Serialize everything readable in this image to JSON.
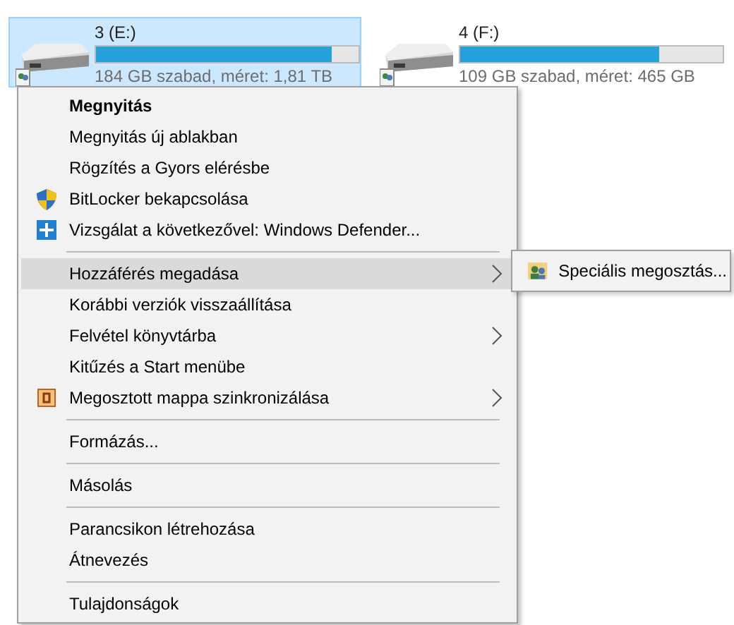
{
  "drives": [
    {
      "name": "3 (E:)",
      "level": 0.9,
      "info": "184 GB szabad, méret: 1,81 TB",
      "selected": true
    },
    {
      "name": "4 (F:)",
      "level": 0.76,
      "info": "109 GB szabad, méret: 465 GB",
      "selected": false
    }
  ],
  "context_menu": [
    {
      "kind": "item",
      "label": "Megnyitás",
      "bold": true,
      "selected": false
    },
    {
      "kind": "item",
      "label": "Megnyitás új ablakban",
      "selected": false
    },
    {
      "kind": "item",
      "label": "Rögzítés a Gyors elérésbe",
      "selected": false
    },
    {
      "kind": "shield",
      "label": "BitLocker bekapcsolása",
      "selected": false
    },
    {
      "kind": "defender",
      "label": "Vizsgálat a következővel: Windows Defender...",
      "selected": false
    },
    {
      "kind": "separator"
    },
    {
      "kind": "item",
      "label": "Hozzáférés megadása",
      "submenu": true,
      "selected": true
    },
    {
      "kind": "item",
      "label": "Korábbi verziók visszaállítása",
      "selected": false
    },
    {
      "kind": "item",
      "label": "Felvétel könyvtárba",
      "submenu": true,
      "selected": false
    },
    {
      "kind": "item",
      "label": "Kitűzés a Start menübe",
      "selected": false
    },
    {
      "kind": "sync",
      "label": "Megosztott mappa szinkronizálása",
      "submenu": true,
      "selected": false
    },
    {
      "kind": "separator"
    },
    {
      "kind": "item",
      "label": "Formázás...",
      "selected": false
    },
    {
      "kind": "separator"
    },
    {
      "kind": "item",
      "label": "Másolás",
      "selected": false
    },
    {
      "kind": "separator"
    },
    {
      "kind": "item",
      "label": "Parancsikon létrehozása",
      "selected": false
    },
    {
      "kind": "item",
      "label": "Átnevezés",
      "selected": false
    },
    {
      "kind": "separator"
    },
    {
      "kind": "item",
      "label": "Tulajdonságok",
      "selected": false
    }
  ],
  "submenu": [
    {
      "kind": "users",
      "label": "Speciális megosztás..."
    }
  ]
}
